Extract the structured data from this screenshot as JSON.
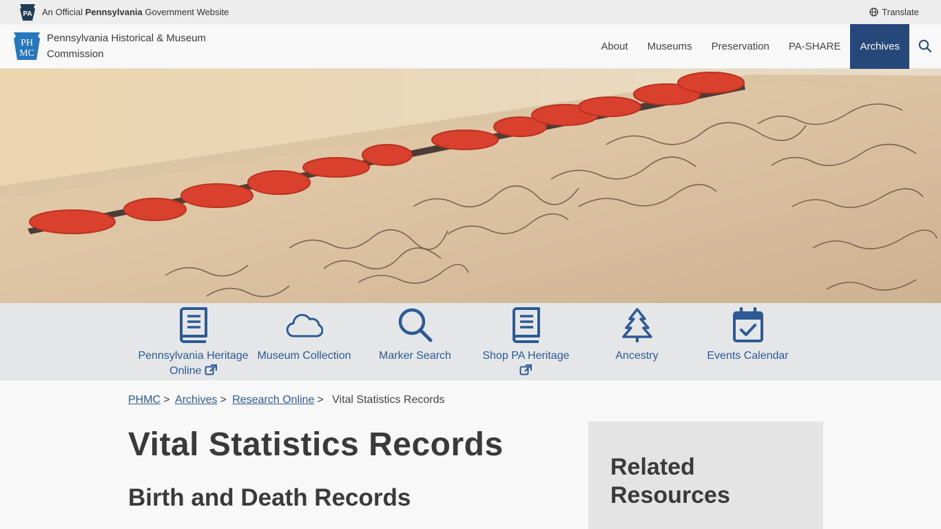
{
  "official_bar": {
    "keystone_text": "PA",
    "prefix": "An Official",
    "state": "Pennsylvania",
    "suffix": "Government Website",
    "translate_label": "Translate"
  },
  "header": {
    "logo_text": "PHMC",
    "brand_name": "Pennsylvania Historical & Museum Commission",
    "nav": [
      {
        "label": "About"
      },
      {
        "label": "Museums"
      },
      {
        "label": "Preservation"
      },
      {
        "label": "PA-SHARE"
      },
      {
        "label": "Archives",
        "active": true
      }
    ]
  },
  "quicklinks": [
    {
      "label": "Pennsylvania Heritage Online",
      "icon": "book-icon",
      "external": true
    },
    {
      "label": "Museum Collection",
      "icon": "cloud-icon",
      "external": false
    },
    {
      "label": "Marker Search",
      "icon": "search-icon",
      "external": false
    },
    {
      "label": "Shop PA Heritage",
      "icon": "book-icon",
      "external": true
    },
    {
      "label": "Ancestry",
      "icon": "tree-icon",
      "external": false
    },
    {
      "label": "Events Calendar",
      "icon": "calendar-check-icon",
      "external": false
    }
  ],
  "breadcrumb": {
    "items": [
      "PHMC",
      "Archives",
      "Research Online"
    ],
    "current": "Vital Statistics Records"
  },
  "main": {
    "title": "Vital Statistics Records",
    "section_title": "Birth and Death Records"
  },
  "sidebar": {
    "title": "Related Resources"
  },
  "colors": {
    "accent": "#26477a",
    "link": "#2b5a95",
    "quicklinks_bg": "#e4e6e8",
    "seal_red": "#d9412e"
  }
}
